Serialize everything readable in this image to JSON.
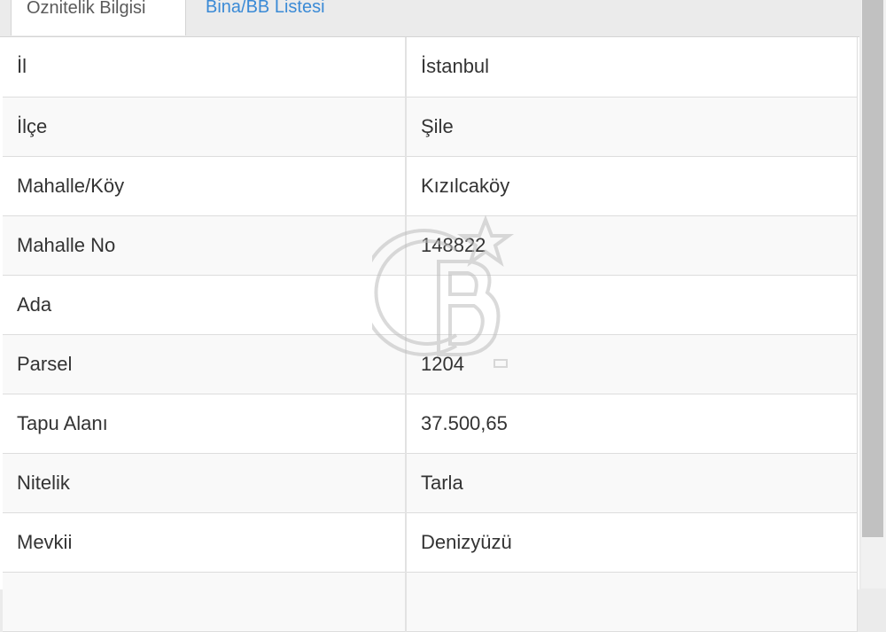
{
  "tabs": [
    {
      "label": "Öznitelik Bilgisi",
      "active": true
    },
    {
      "label": "Bina/BB Listesi",
      "active": false
    }
  ],
  "attributes": [
    {
      "label": "İl",
      "value": "İstanbul"
    },
    {
      "label": "İlçe",
      "value": "Şile"
    },
    {
      "label": "Mahalle/Köy",
      "value": "Kızılcaköy"
    },
    {
      "label": "Mahalle No",
      "value": "148822"
    },
    {
      "label": "Ada",
      "value": ""
    },
    {
      "label": "Parsel",
      "value": "1204"
    },
    {
      "label": "Tapu Alanı",
      "value": "37.500,65"
    },
    {
      "label": "Nitelik",
      "value": "Tarla"
    },
    {
      "label": "Mevkii",
      "value": "Denizyüzü"
    },
    {
      "label": "",
      "value": ""
    }
  ],
  "watermark": {
    "text": "CB",
    "color": "#bdbdbd"
  },
  "colors": {
    "tab_link": "#3a8ad6",
    "text": "#333333",
    "row_alt": "#f9f9f9"
  }
}
